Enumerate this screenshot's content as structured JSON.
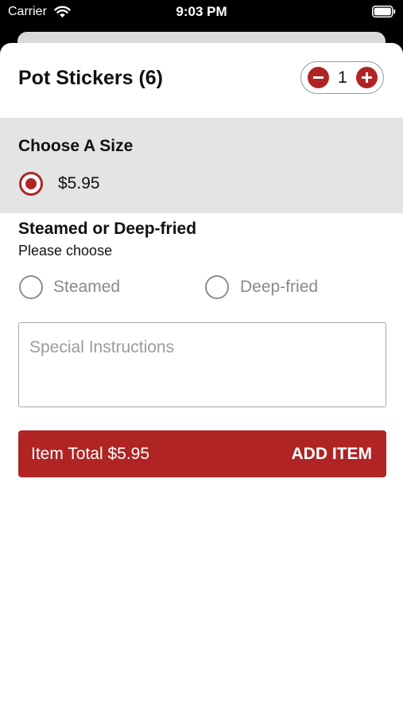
{
  "status_bar": {
    "carrier": "Carrier",
    "time": "9:03 PM"
  },
  "item": {
    "title": "Pot Stickers (6)",
    "quantity": "1"
  },
  "size_section": {
    "title": "Choose A Size",
    "options": [
      {
        "label": "$5.95",
        "selected": true
      }
    ]
  },
  "prep_section": {
    "title": "Steamed or Deep-fried",
    "subtitle": "Please choose",
    "options": [
      {
        "label": "Steamed",
        "selected": false
      },
      {
        "label": "Deep-fried",
        "selected": false
      }
    ]
  },
  "instructions": {
    "placeholder": "Special Instructions"
  },
  "add_bar": {
    "total_label": "Item Total $5.95",
    "action_label": "ADD ITEM"
  },
  "colors": {
    "accent": "#b02424",
    "section_bg": "#e3e4e6"
  }
}
